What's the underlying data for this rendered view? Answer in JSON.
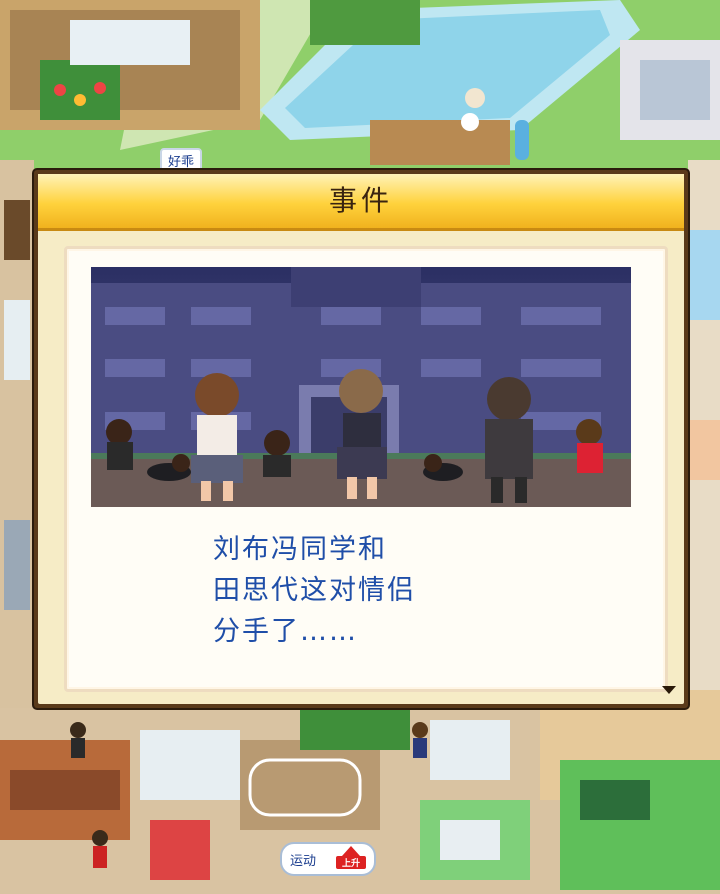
{
  "world": {
    "sign_label": "好乖",
    "button_label": "运动",
    "badge_label": "上升"
  },
  "event_dialog": {
    "title": "事件",
    "message_lines": [
      "刘布冯同学和",
      "田思代这对情侣",
      "分手了……"
    ],
    "continue_icon": "triangle-down-icon"
  },
  "colors": {
    "title_gold": "#ffd23c",
    "frame_brown": "#5a3a1a",
    "message_blue": "#1f4ea8",
    "panel_cream": "#f6ecc6"
  }
}
